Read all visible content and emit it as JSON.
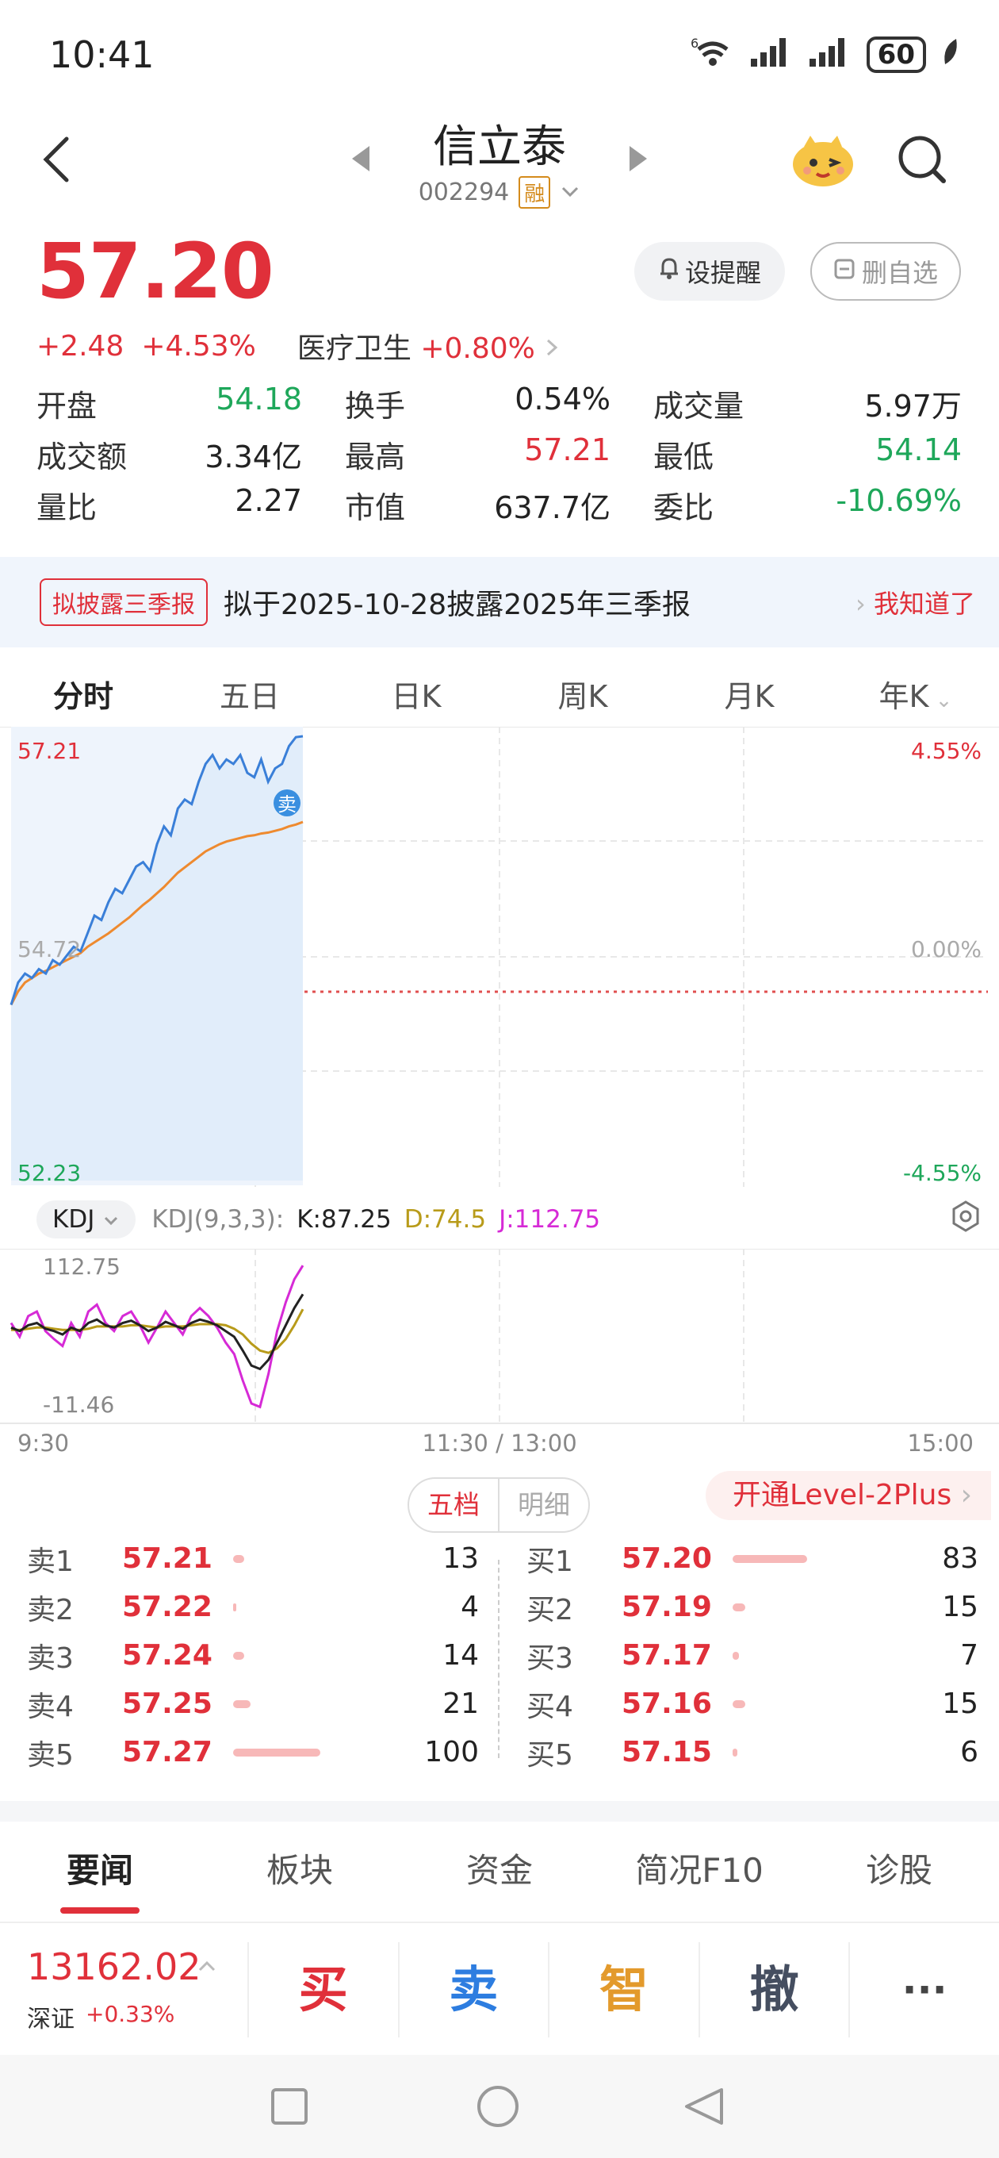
{
  "status_bar": {
    "time": "10:41",
    "signal_label": "6",
    "battery": "60"
  },
  "header": {
    "stock_name": "信立泰",
    "stock_code": "002294",
    "margin_tag": "融"
  },
  "quote": {
    "price": "57.20",
    "change": "+2.48",
    "change_pct": "+4.53%",
    "sector_name": "医疗卫生",
    "sector_change": "+0.80%",
    "alert_button": "设提醒",
    "watchlist_button": "删自选"
  },
  "stats": [
    [
      {
        "label": "开盘",
        "value": "54.18",
        "color": "green"
      },
      {
        "label": "换手",
        "value": "0.54%",
        "color": "black"
      },
      {
        "label": "成交量",
        "value": "5.97万",
        "color": "black"
      }
    ],
    [
      {
        "label": "成交额",
        "value": "3.34亿",
        "color": "black"
      },
      {
        "label": "最高",
        "value": "57.21",
        "color": "red"
      },
      {
        "label": "最低",
        "value": "54.14",
        "color": "green"
      }
    ],
    [
      {
        "label": "量比",
        "value": "2.27",
        "color": "black"
      },
      {
        "label": "市值",
        "value": "637.7亿",
        "color": "black"
      },
      {
        "label": "委比",
        "value": "-10.69%",
        "color": "green"
      }
    ]
  ],
  "notice": {
    "tag": "拟披露三季报",
    "text": "拟于2025-10-28披露2025年三季报",
    "dismiss": "我知道了"
  },
  "period_tabs": [
    "分时",
    "五日",
    "日K",
    "周K",
    "月K",
    "年K"
  ],
  "chart": {
    "price_high": "57.21",
    "price_low": "52.23",
    "price_mid": "54.72",
    "pct_high": "4.55%",
    "pct_mid": "0.00%",
    "pct_low": "-4.55%",
    "sell_marker": "卖",
    "time_start": "9:30",
    "time_mid": "11:30 / 13:00",
    "time_end": "15:00"
  },
  "chart_data": {
    "type": "line",
    "ylim": [
      52.23,
      57.21
    ],
    "series": [
      {
        "values": [
          54.2,
          54.45,
          54.55,
          54.5,
          54.6,
          54.55,
          54.7,
          54.65,
          54.75,
          54.85,
          54.8,
          55.0,
          55.2,
          55.15,
          55.35,
          55.5,
          55.45,
          55.6,
          55.75,
          55.8,
          55.7,
          56.0,
          56.2,
          56.1,
          56.4,
          56.5,
          56.45,
          56.7,
          56.9,
          57.0,
          56.85,
          56.95,
          56.9,
          57.0,
          56.8,
          56.75,
          56.95,
          56.7,
          56.85,
          56.9,
          57.1,
          57.2,
          57.21
        ]
      },
      {
        "values": [
          54.2,
          54.35,
          54.45,
          54.5,
          54.55,
          54.58,
          54.62,
          54.66,
          54.7,
          54.74,
          54.78,
          54.85,
          54.9,
          54.95,
          55.0,
          55.06,
          55.12,
          55.18,
          55.25,
          55.32,
          55.38,
          55.45,
          55.52,
          55.6,
          55.68,
          55.74,
          55.8,
          55.86,
          55.92,
          55.96,
          56.0,
          56.03,
          56.05,
          56.07,
          56.09,
          56.1,
          56.12,
          56.13,
          56.15,
          56.17,
          56.2,
          56.22,
          56.25
        ]
      }
    ],
    "x_labels": [
      "9:30",
      "11:30 / 13:00",
      "15:00"
    ]
  },
  "kdj": {
    "selector": "KDJ",
    "params": "KDJ(9,3,3):",
    "k": "K:87.25",
    "d": "D:74.5",
    "j": "J:112.75",
    "top": "112.75",
    "bottom": "-11.46",
    "k_values": [
      58,
      55,
      60,
      62,
      57,
      55,
      52,
      58,
      55,
      62,
      65,
      60,
      58,
      62,
      64,
      60,
      55,
      58,
      63,
      60,
      57,
      62,
      65,
      63,
      60,
      55,
      50,
      38,
      25,
      22,
      30,
      45,
      60,
      75,
      87
    ],
    "d_values": [
      56,
      56,
      57,
      58,
      58,
      57,
      56,
      56,
      56,
      57,
      59,
      59,
      59,
      59,
      60,
      60,
      59,
      58,
      59,
      59,
      59,
      60,
      61,
      61,
      61,
      60,
      57,
      52,
      44,
      38,
      36,
      40,
      48,
      60,
      74
    ],
    "j_values": [
      62,
      50,
      68,
      72,
      55,
      48,
      42,
      62,
      50,
      72,
      78,
      62,
      55,
      68,
      72,
      60,
      45,
      58,
      72,
      62,
      52,
      68,
      75,
      68,
      58,
      45,
      35,
      12,
      -8,
      -11,
      18,
      55,
      80,
      100,
      112
    ]
  },
  "order_book": {
    "tab_active": "五档",
    "tab_inactive": "明细",
    "level2": "开通Level-2Plus",
    "sell": [
      {
        "label": "卖1",
        "price": "57.21",
        "vol": "13",
        "bar": 0.07
      },
      {
        "label": "卖2",
        "price": "57.22",
        "vol": "4",
        "bar": 0.02
      },
      {
        "label": "卖3",
        "price": "57.24",
        "vol": "14",
        "bar": 0.07
      },
      {
        "label": "卖4",
        "price": "57.25",
        "vol": "21",
        "bar": 0.11
      },
      {
        "label": "卖5",
        "price": "57.27",
        "vol": "100",
        "bar": 0.55
      }
    ],
    "buy": [
      {
        "label": "买1",
        "price": "57.20",
        "vol": "83",
        "bar": 0.47
      },
      {
        "label": "买2",
        "price": "57.19",
        "vol": "15",
        "bar": 0.08
      },
      {
        "label": "买3",
        "price": "57.17",
        "vol": "7",
        "bar": 0.04
      },
      {
        "label": "买4",
        "price": "57.16",
        "vol": "15",
        "bar": 0.08
      },
      {
        "label": "买5",
        "price": "57.15",
        "vol": "6",
        "bar": 0.03
      }
    ]
  },
  "bottom_tabs": [
    "要闻",
    "板块",
    "资金",
    "简况F10",
    "诊股"
  ],
  "index_bar": {
    "value": "13162.02",
    "name": "深证",
    "pct": "+0.33%"
  },
  "trade_buttons": {
    "buy": "买",
    "sell": "卖",
    "smart": "智",
    "cancel": "撤",
    "more": "···"
  }
}
